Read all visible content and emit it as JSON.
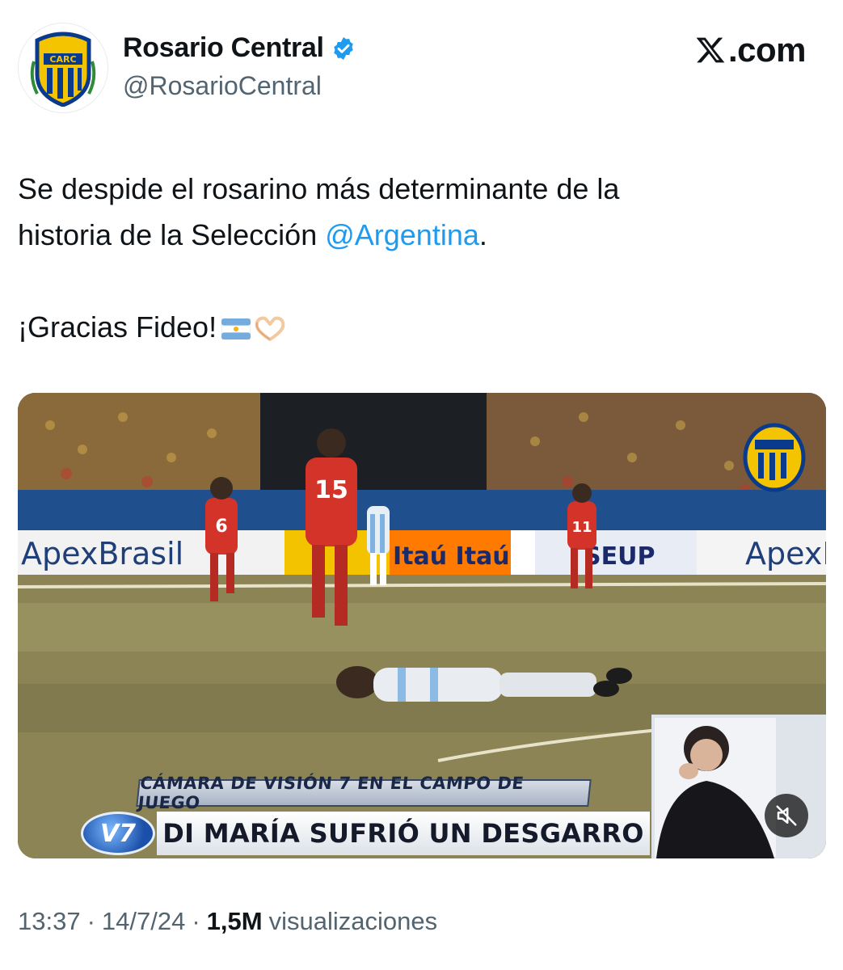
{
  "author": {
    "display_name": "Rosario Central",
    "handle": "@RosarioCentral",
    "verified": true,
    "avatar_icon": "rosario-central-crest",
    "crest_text": "CARC"
  },
  "brand": {
    "label": ".com",
    "icon": "x-logo-icon"
  },
  "tweet": {
    "line1": "Se despide el rosarino más determinante de la",
    "line2_prefix": "historia de la Selección ",
    "mention": "@Argentina",
    "line2_suffix": ".",
    "line3": "¡Gracias Fideo!",
    "emojis": [
      "argentina-flag",
      "heart-hands"
    ]
  },
  "media": {
    "type": "video",
    "ticker_top": "CÁMARA DE VISIÓN 7 EN EL CAMPO DE JUEGO",
    "ticker_bottom": "DI MARÍA SUFRIÓ UN DESGARRO",
    "channel_logo": "V7",
    "ad_board_left": "ApexBrasil",
    "ad_board_mid": "Itaú Itaú",
    "ad_board_right": "ApexBr",
    "ad_board_center": "SEUP",
    "mute_icon": "muted-speaker-icon",
    "player_numbers": [
      "6",
      "15",
      "11"
    ]
  },
  "meta": {
    "time": "13:37",
    "separator": "·",
    "date": "14/7/24",
    "views_count": "1,5M",
    "views_label": "visualizaciones"
  },
  "colors": {
    "accent": "#1d9bf0",
    "secondary_text": "#536471",
    "primary_text": "#0f1419",
    "crest_blue": "#0a3a8c",
    "crest_yellow": "#f5c400"
  }
}
